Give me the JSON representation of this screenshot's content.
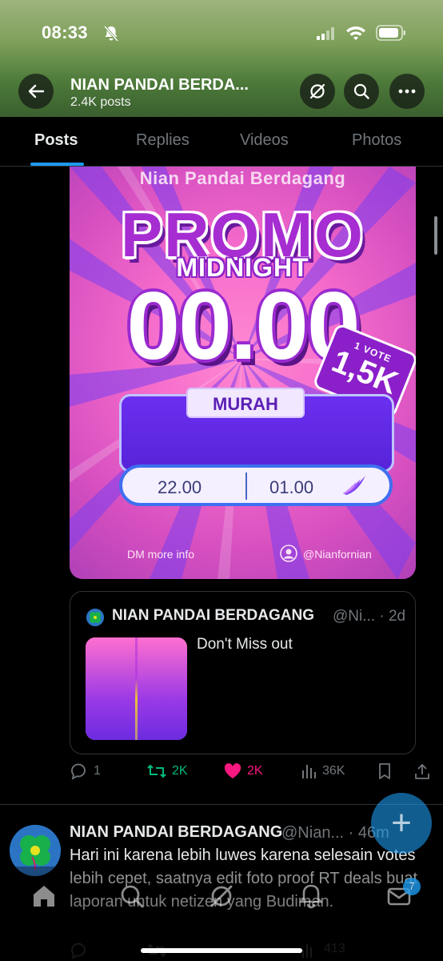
{
  "status_bar": {
    "time": "08:33"
  },
  "profile": {
    "name": "NIAN PANDAI BERDA...",
    "posts": "2.4K posts"
  },
  "tabs": [
    {
      "label": "Posts",
      "active": true
    },
    {
      "label": "Replies",
      "active": false
    },
    {
      "label": "Videos",
      "active": false
    },
    {
      "label": "Photos",
      "active": false
    }
  ],
  "promo_image": {
    "brand": "Nian Pandai Berdagang",
    "headline": "PROMO",
    "subheadline": "MIDNIGHT",
    "big_time": "00.00",
    "vote_tag_small": "1 VOTE",
    "vote_tag_big": "1,5K",
    "murah_label": "MURAH",
    "time_start": "22.00",
    "time_end": "01.00",
    "dm_text": "DM more info",
    "username": "@Nianfornian"
  },
  "quote": {
    "name": "NIAN PANDAI BERDAGANG",
    "handle": "@Ni... · 2d",
    "text": "Don't Miss out"
  },
  "actions": {
    "replies": "1",
    "reposts": "2K",
    "likes": "2K",
    "views": "36K"
  },
  "tweet2": {
    "name": "NIAN PANDAI BERDAGANG",
    "handle": "@Nian... · 46m",
    "body": "Hari ini karena lebih luwes karena selesain votes lebih cepet, saatnya edit foto proof RT deals buat laporan untuk netizen yang Budiman."
  },
  "tweet2_actions": {
    "views": "413"
  },
  "bottom_nav": {
    "messages_badge": "7"
  },
  "colors": {
    "accent": "#1d9bf0",
    "repost": "#00ba7c",
    "like": "#f91880",
    "muted": "#71767b",
    "background": "#000000"
  }
}
